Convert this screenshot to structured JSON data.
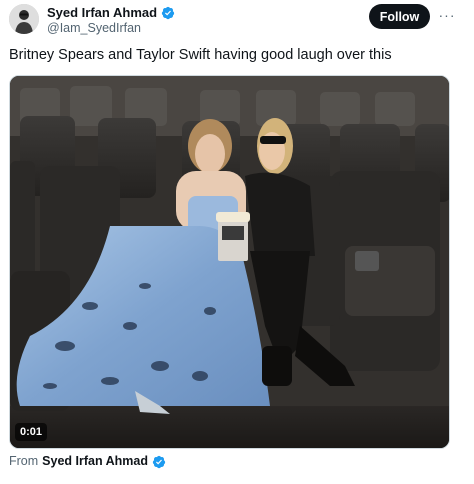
{
  "post": {
    "author": {
      "display_name": "Syed Irfan Ahmad",
      "handle": "@Iam_SyedIrfan",
      "verified_icon": "verified-badge-icon",
      "avatar_icon": "avatar"
    },
    "follow_label": "Follow",
    "more_label": "···",
    "text": "Britney Spears and Taylor Swift having good laugh over this",
    "media": {
      "kind": "video",
      "timestamp": "0:01"
    },
    "source": {
      "from_label": "From",
      "name": "Syed Irfan Ahmad"
    }
  },
  "colors": {
    "text": "#0f1419",
    "secondary": "#536471",
    "follow_bg": "#0f1419",
    "verified": "#1d9bf0"
  }
}
